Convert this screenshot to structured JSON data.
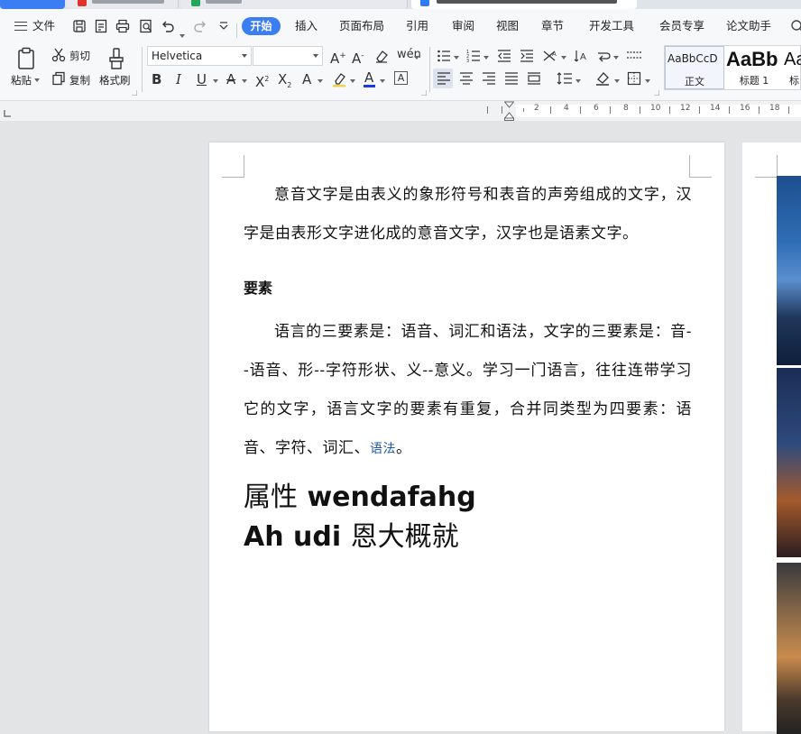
{
  "menu": {
    "file": "文件",
    "tabs": [
      "开始",
      "插入",
      "页面布局",
      "引用",
      "审阅",
      "视图",
      "章节",
      "开发工具",
      "会员专享",
      "论文助手"
    ]
  },
  "ribbon": {
    "paste": "粘贴",
    "cut": "剪切",
    "copy": "复制",
    "format_painter": "格式刷",
    "font_name": "Helvetica",
    "font_size": "",
    "styles": [
      {
        "preview": "AaBbCcD",
        "name": "正文"
      },
      {
        "preview": "AaBb",
        "name": "标题 1"
      },
      {
        "preview": "Aa",
        "name": "标"
      }
    ]
  },
  "ruler": {
    "labels": [
      "2",
      "4",
      "6",
      "8",
      "10",
      "12",
      "14",
      "16",
      "18"
    ]
  },
  "document": {
    "para1": "意音文字是由表义的象形符号和表音的声旁组成的文字，汉字是由表形文字进化成的意音文字，汉字也是语素文字。",
    "heading": "要素",
    "para2_main": "语言的三要素是：语音、词汇和语法，文字的三要素是：音--语音、形--字符形状、义--意义。学习一门语言，往往连带学习它的文字，语言文字的要素有重复，合并同类型为四要素：语音、字符、词汇、",
    "para2_link": "语法",
    "para2_end": "。",
    "title_line1_cn": "属性",
    "title_line1_en": " wendafahg",
    "title_line2_en": "Ah udi ",
    "title_line2_cn": "恩大概就"
  },
  "colors": {
    "accent": "#3b7df2",
    "link": "#1c5aa8"
  }
}
